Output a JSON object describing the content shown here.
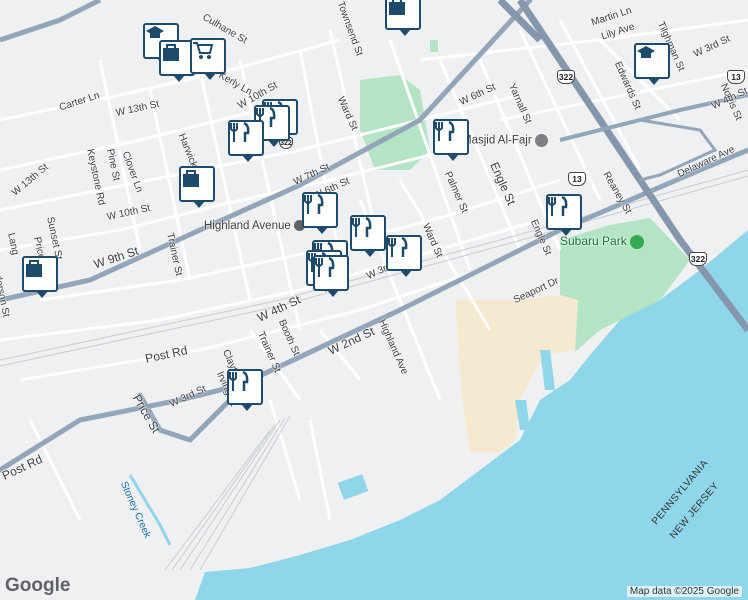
{
  "roads": [
    {
      "name": "Carter Ln"
    },
    {
      "name": "W 13th St"
    },
    {
      "name": "W 13th St"
    },
    {
      "name": "Clover Ln"
    },
    {
      "name": "Pine St"
    },
    {
      "name": "Keystone Rd"
    },
    {
      "name": "W 10th St"
    },
    {
      "name": "Sunset St"
    },
    {
      "name": "Price St"
    },
    {
      "name": "Lang"
    },
    {
      "name": "W 9th St"
    },
    {
      "name": "Trainer St"
    },
    {
      "name": "Harwick"
    },
    {
      "name": "Culhane St"
    },
    {
      "name": "Kerly Ln"
    },
    {
      "name": "W 10th St"
    },
    {
      "name": "W 7th St"
    },
    {
      "name": "W 6th St"
    },
    {
      "name": "Ward St"
    },
    {
      "name": "Townsend St"
    },
    {
      "name": "W 6th St"
    },
    {
      "name": "Yarnall St"
    },
    {
      "name": "Engle St"
    },
    {
      "name": "Palmer St"
    },
    {
      "name": "Ward St"
    },
    {
      "name": "W 3rd St"
    },
    {
      "name": "W 4th St"
    },
    {
      "name": "Post Rd"
    },
    {
      "name": "Booth St"
    },
    {
      "name": "Trainer St"
    },
    {
      "name": "W 2nd St"
    },
    {
      "name": "Highland Ave"
    },
    {
      "name": "Clayton St"
    },
    {
      "name": "Irving St"
    },
    {
      "name": "W 3rd St"
    },
    {
      "name": "Price St"
    },
    {
      "name": "Post Rd"
    },
    {
      "name": "Engle St"
    },
    {
      "name": "Reaney St"
    },
    {
      "name": "Seaport Dr"
    },
    {
      "name": "Martin Ln"
    },
    {
      "name": "Lily Ave"
    },
    {
      "name": "W 3rd St"
    },
    {
      "name": "Tilghman St"
    },
    {
      "name": "Edwards St"
    },
    {
      "name": "Norris St"
    },
    {
      "name": "Delaware Ave"
    },
    {
      "name": "W 4th St"
    },
    {
      "name": "Anderson St"
    }
  ],
  "pois": [
    {
      "name": "Highland Avenue",
      "kind": "transit-station"
    },
    {
      "name": "Masjid Al-Fajr",
      "kind": "place-of-worship"
    },
    {
      "name": "Subaru Park",
      "kind": "stadium"
    }
  ],
  "water_labels": [
    {
      "name": "Stoney Creek"
    }
  ],
  "state_line": {
    "upper": "PENNSYLVANIA",
    "lower": "NEW JERSEY"
  },
  "route_shields": [
    "322",
    "13",
    "13",
    "322",
    "322"
  ],
  "markers": [
    {
      "icon": "graduation-cap-icon"
    },
    {
      "icon": "shopping-bag-icon"
    },
    {
      "icon": "shopping-cart-icon"
    },
    {
      "icon": "shopping-bag-icon"
    },
    {
      "icon": "graduation-cap-icon"
    },
    {
      "icon": "restaurant-icon"
    },
    {
      "icon": "restaurant-icon"
    },
    {
      "icon": "restaurant-icon"
    },
    {
      "icon": "restaurant-icon"
    },
    {
      "icon": "shopping-bag-icon"
    },
    {
      "icon": "restaurant-icon"
    },
    {
      "icon": "restaurant-icon"
    },
    {
      "icon": "restaurant-icon"
    },
    {
      "icon": "restaurant-icon"
    },
    {
      "icon": "restaurant-icon"
    },
    {
      "icon": "restaurant-icon"
    },
    {
      "icon": "restaurant-icon"
    },
    {
      "icon": "shopping-bag-icon"
    },
    {
      "icon": "restaurant-icon"
    }
  ],
  "branding": {
    "logo": "Google",
    "copyright": "Map data ©2025 Google"
  },
  "colors": {
    "water": "#8fd6ea",
    "park": "#b5e4c4",
    "sand": "#f5ead0",
    "road": "#ffffff",
    "highway": "#93a5b8",
    "marker_border": "#1e4a6b"
  }
}
